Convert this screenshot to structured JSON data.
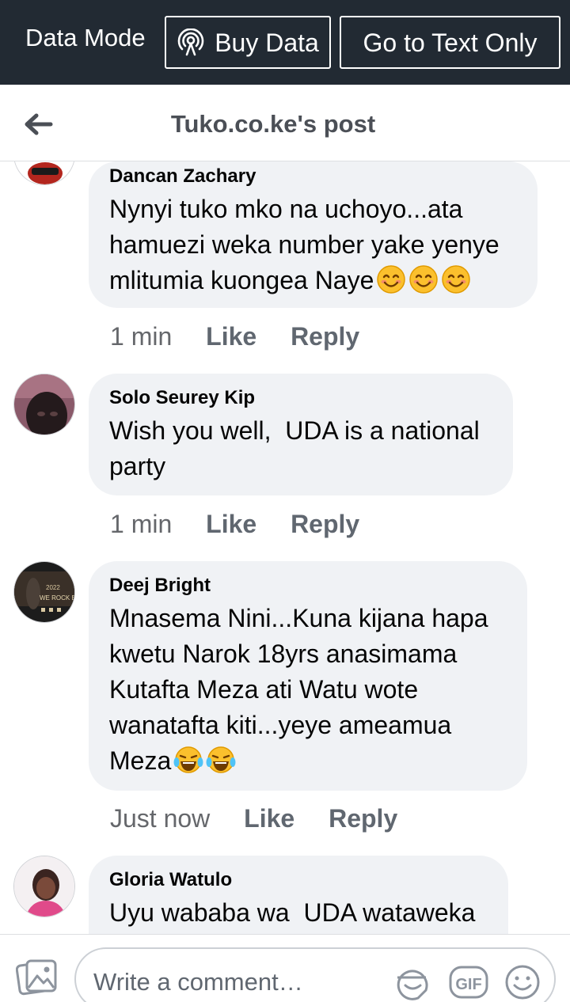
{
  "data_mode": {
    "label": "Data Mode",
    "buy_data_label": "Buy Data",
    "text_only_label": "Go to Text Only"
  },
  "header": {
    "title": "Tuko.co.ke's post"
  },
  "comments": [
    {
      "author": "Dancan Zachary",
      "text": "Nynyi tuko mko na uchoyo...ata hamuezi weka number yake yenye mlitumia kuongea Naye",
      "emoji": [
        "smiling-face-emoji",
        "smiling-face-emoji",
        "smiling-face-emoji"
      ],
      "time": "1 min",
      "like_label": "Like",
      "reply_label": "Reply"
    },
    {
      "author": "Solo Seurey Kip",
      "text": "Wish you well,  UDA is a national party",
      "time": "1 min",
      "like_label": "Like",
      "reply_label": "Reply"
    },
    {
      "author": "Deej Bright",
      "text": "Mnasema Nini...Kuna kijana hapa kwetu Narok 18yrs anasimama Kutafta Meza ati Watu wote wanatafta kiti...yeye ameamua Meza",
      "emoji": [
        "tears-of-joy-emoji",
        "tears-of-joy-emoji"
      ],
      "avatar_text": [
        "2022",
        "WE ROCK BA"
      ],
      "time": "Just now",
      "like_label": "Like",
      "reply_label": "Reply"
    },
    {
      "author": "Gloria Watulo",
      "text": "Uyu wababa wa  UDA wataweka"
    }
  ],
  "composer": {
    "placeholder": "Write a comment…",
    "gif_label": "GIF"
  }
}
